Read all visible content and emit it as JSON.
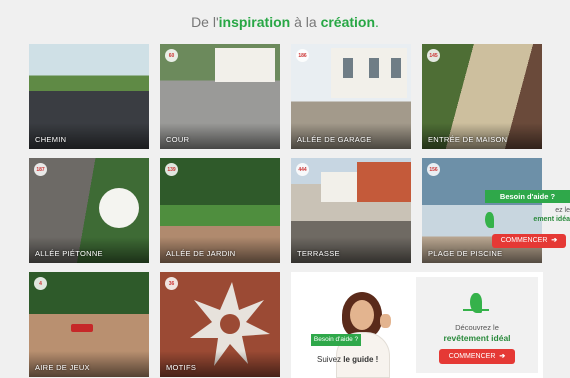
{
  "title": {
    "prefix": "De l'",
    "word1": "inspiration",
    "middle": " à la ",
    "word2": "création",
    "suffix": "."
  },
  "tiles": [
    {
      "id": "chemin",
      "caption": "CHEMIN",
      "badge": ""
    },
    {
      "id": "cour",
      "caption": "COUR",
      "badge": "60"
    },
    {
      "id": "garage",
      "caption": "ALLÉE DE GARAGE",
      "badge": "186"
    },
    {
      "id": "entree",
      "caption": "ENTRÉE DE MAISON",
      "badge": "145"
    },
    {
      "id": "pietonne",
      "caption": "ALLÉE PIÉTONNE",
      "badge": "187"
    },
    {
      "id": "jardin",
      "caption": "ALLÉE DE JARDIN",
      "badge": "139"
    },
    {
      "id": "terrasse",
      "caption": "TERRASSE",
      "badge": "444"
    },
    {
      "id": "piscine",
      "caption": "PLAGE DE PISCINE",
      "badge": "156"
    },
    {
      "id": "jeux",
      "caption": "AIRE DE JEUX",
      "badge": "4"
    },
    {
      "id": "motifs",
      "caption": "MOTIFS",
      "badge": "36"
    }
  ],
  "help_widget": {
    "tag": "Besoin d'aide ?",
    "line1": "ez le",
    "line2": "ement idéa",
    "button": "COMMENCER"
  },
  "promo": {
    "tag": "Besoin d'aide ?",
    "follow_prefix": "Suivez ",
    "follow_bold": "le guide !",
    "discover": "Découvrez le",
    "highlight": "revêtement idéal",
    "button": "COMMENCER"
  },
  "colors": {
    "accent": "#28a745",
    "cta": "#e53935"
  }
}
